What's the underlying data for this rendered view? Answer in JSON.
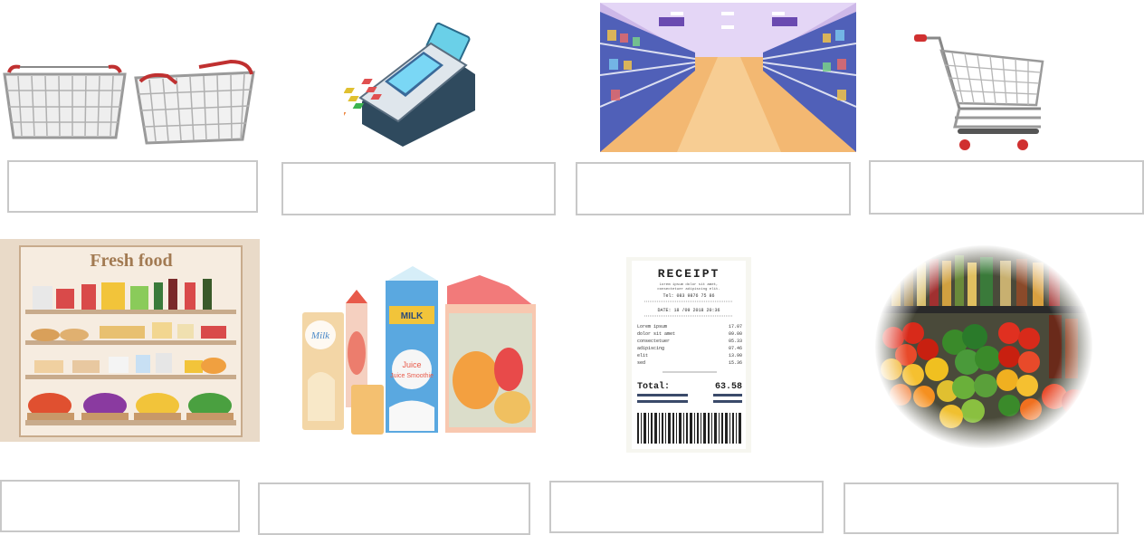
{
  "worksheet": {
    "pictures": [
      {
        "subject": "baskets"
      },
      {
        "subject": "card-terminal"
      },
      {
        "subject": "supermarket-aisle"
      },
      {
        "subject": "trolley"
      },
      {
        "subject": "shelves",
        "sign": "Fresh food"
      },
      {
        "subject": "packaged-drinks",
        "pack_labels": [
          "Milk",
          "MILK",
          "Juice",
          "Juice Smoothie"
        ]
      },
      {
        "subject": "receipt",
        "title": "RECEIPT",
        "lorem_lines": [
          "Lorem ipsum dolor sit amet,",
          "consectetuer adipiscing elit."
        ],
        "tel": "Tel: 083 9876 75 86",
        "date": "DATE: 18 /09 2018 20:36",
        "items": [
          {
            "name": "Lorem ipsum",
            "price": "17.07"
          },
          {
            "name": "dolor sit amet",
            "price": "09.00"
          },
          {
            "name": "consectetuer",
            "price": "05.33"
          },
          {
            "name": "adipiscing",
            "price": "07.46"
          },
          {
            "name": "elit",
            "price": "13.90"
          },
          {
            "name": "sed",
            "price": "15.36"
          }
        ],
        "total_label": "Total:",
        "total_value": "63.58"
      },
      {
        "subject": "produce-display"
      }
    ],
    "answer_boxes": [
      {
        "value": "",
        "placeholder": ""
      },
      {
        "value": "",
        "placeholder": ""
      },
      {
        "value": "",
        "placeholder": ""
      },
      {
        "value": "",
        "placeholder": ""
      },
      {
        "value": "",
        "placeholder": ""
      },
      {
        "value": "",
        "placeholder": ""
      },
      {
        "value": "",
        "placeholder": ""
      },
      {
        "value": "",
        "placeholder": ""
      }
    ]
  }
}
